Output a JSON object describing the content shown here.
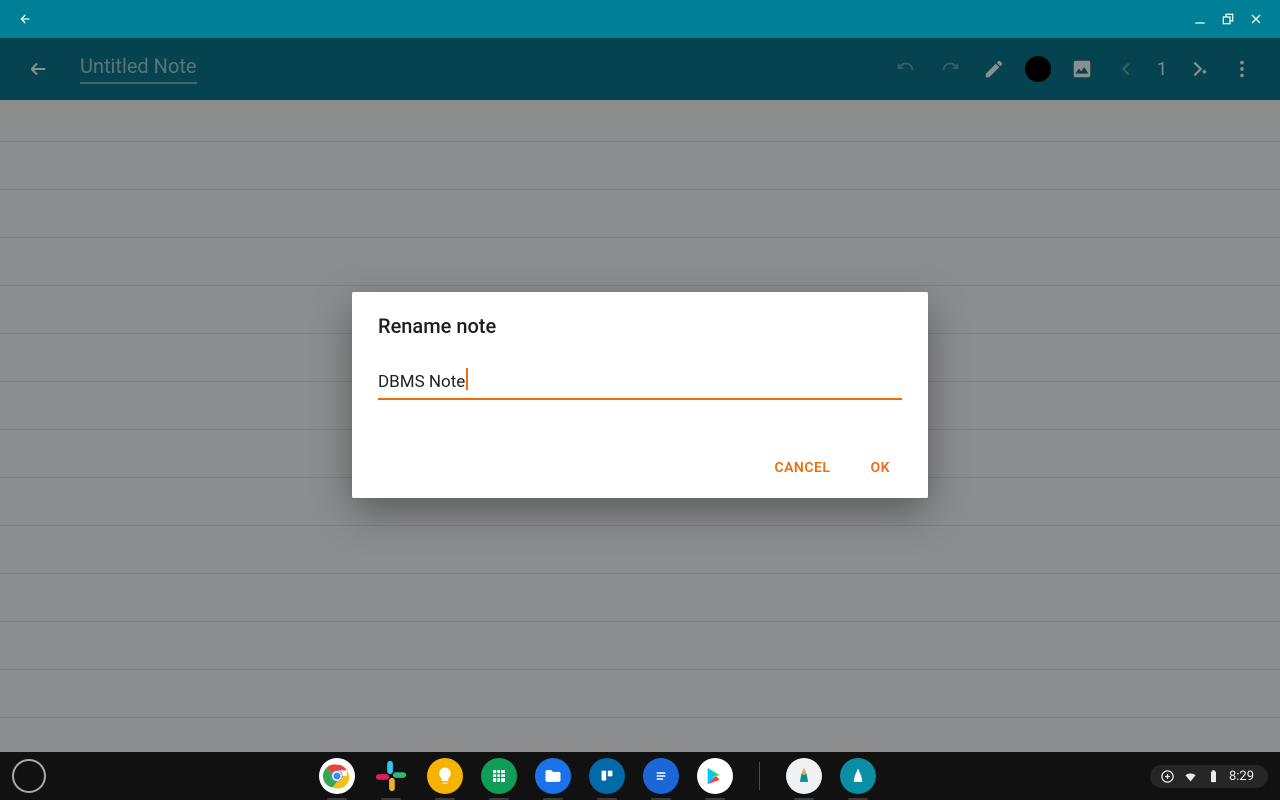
{
  "window": {
    "back_label": "Back",
    "minimize_label": "Minimize",
    "maximize_label": "Restore",
    "close_label": "Close"
  },
  "app_toolbar": {
    "back_label": "Back",
    "note_title": "Untitled Note",
    "undo_label": "Undo",
    "redo_label": "Redo",
    "pen_label": "Pen",
    "color_label": "Ink color",
    "ink_color": "#000000",
    "image_label": "Insert image",
    "prev_page_label": "Previous page",
    "page_number": "1",
    "add_page_label": "Add page",
    "overflow_label": "More options"
  },
  "dialog": {
    "title": "Rename note",
    "input_value": "DBMS Note",
    "cancel_label": "CANCEL",
    "ok_label": "OK"
  },
  "shelf": {
    "launcher_label": "Launcher",
    "apps": [
      {
        "name": "chrome",
        "label": "Google Chrome"
      },
      {
        "name": "slack",
        "label": "Slack"
      },
      {
        "name": "keep",
        "label": "Google Keep"
      },
      {
        "name": "sheets",
        "label": "Google Sheets"
      },
      {
        "name": "files",
        "label": "Files"
      },
      {
        "name": "trello",
        "label": "Trello"
      },
      {
        "name": "docs",
        "label": "Google Docs"
      },
      {
        "name": "play",
        "label": "Play Store"
      },
      {
        "name": "squid-light",
        "label": "Squid"
      },
      {
        "name": "squid-dark",
        "label": "Squid (active)"
      }
    ],
    "status": {
      "notifications_label": "Notifications",
      "wifi_label": "Wi-Fi",
      "battery_label": "Battery",
      "time": "8:29"
    }
  },
  "colors": {
    "accent": "#ed6c0c",
    "chrome_dark": "#008096",
    "app_toolbar": "#077489"
  }
}
